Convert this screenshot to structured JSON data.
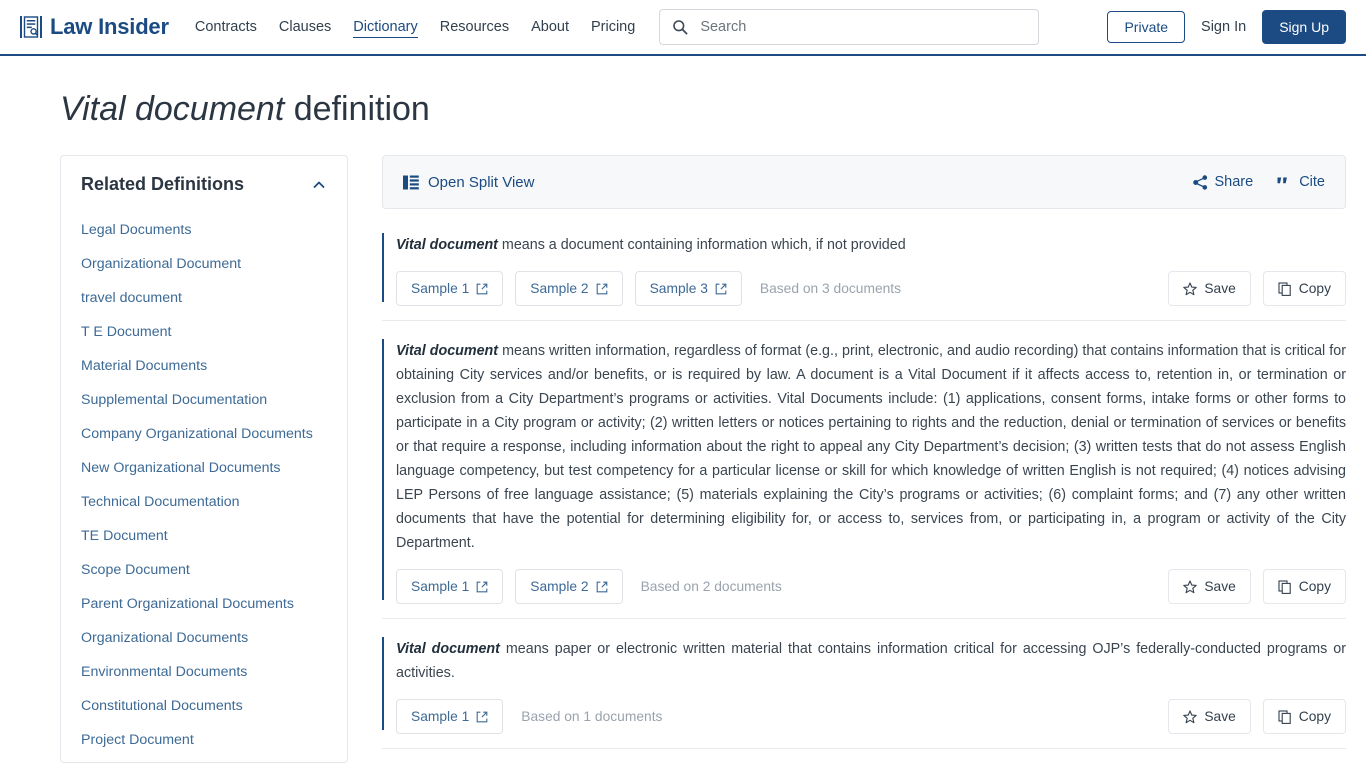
{
  "header": {
    "logo_text": "Law Insider",
    "logo_icon": "document-search-icon",
    "nav": [
      {
        "label": "Contracts",
        "active": false
      },
      {
        "label": "Clauses",
        "active": false
      },
      {
        "label": "Dictionary",
        "active": true
      },
      {
        "label": "Resources",
        "active": false
      },
      {
        "label": "About",
        "active": false
      },
      {
        "label": "Pricing",
        "active": false
      }
    ],
    "search": {
      "placeholder": "Search",
      "value": "",
      "icon": "search-icon"
    },
    "private_label": "Private",
    "signin_label": "Sign In",
    "signup_label": "Sign Up",
    "accent_color": "#1b4b82"
  },
  "page": {
    "title_term": "Vital document",
    "title_suffix": " definition"
  },
  "sidebar": {
    "title": "Related Definitions",
    "collapse_icon": "chevron-up-icon",
    "items": [
      {
        "label": "Legal Documents"
      },
      {
        "label": "Organizational Document"
      },
      {
        "label": "travel document"
      },
      {
        "label": "T E Document"
      },
      {
        "label": "Material Documents"
      },
      {
        "label": "Supplemental Documentation"
      },
      {
        "label": "Company Organizational Documents"
      },
      {
        "label": "New Organizational Documents"
      },
      {
        "label": "Technical Documentation"
      },
      {
        "label": "TE Document"
      },
      {
        "label": "Scope Document"
      },
      {
        "label": "Parent Organizational Documents"
      },
      {
        "label": "Organizational Documents"
      },
      {
        "label": "Environmental Documents"
      },
      {
        "label": "Constitutional Documents"
      },
      {
        "label": "Project Document"
      }
    ]
  },
  "toolbar": {
    "split_view_label": "Open Split View",
    "split_view_icon": "split-view-icon",
    "share_label": "Share",
    "share_icon": "share-icon",
    "cite_label": "Cite",
    "cite_icon": "quote-icon"
  },
  "definitions": [
    {
      "term": "Vital document",
      "body": " means a document containing information which, if not provided",
      "samples": [
        {
          "label": "Sample 1",
          "icon": "external-link-icon"
        },
        {
          "label": "Sample 2",
          "icon": "external-link-icon"
        },
        {
          "label": "Sample 3",
          "icon": "external-link-icon"
        }
      ],
      "based_on": "Based on 3 documents",
      "save_label": "Save",
      "save_icon": "star-icon",
      "copy_label": "Copy",
      "copy_icon": "copy-icon"
    },
    {
      "term": "Vital document",
      "body": " means written information, regardless of format (e.g., print, electronic, and audio recording) that contains information that is critical for obtaining City services and/or benefits, or is required by law. A document is a Vital Document if it affects access to, retention in, or termination or exclusion from a City Department’s programs or activities. Vital Documents include: (1) applications, consent forms, intake forms or other forms to participate in a City program or activity; (2) written letters or notices pertaining to rights and the reduction, denial or termination of services or benefits or that require a response, including information about the right to appeal any City Department’s decision; (3) written tests that do not assess English language competency, but test competency for a particular license or skill for which knowledge of written English is not required; (4) notices advising LEP Persons of free language assistance; (5) materials explaining the City’s programs or activities; (6) complaint forms; and (7) any other written documents that have the potential for determining eligibility for, or access to, services from, or participating in, a program or activity of the City Department.",
      "samples": [
        {
          "label": "Sample 1",
          "icon": "external-link-icon"
        },
        {
          "label": "Sample 2",
          "icon": "external-link-icon"
        }
      ],
      "based_on": "Based on 2 documents",
      "save_label": "Save",
      "save_icon": "star-icon",
      "copy_label": "Copy",
      "copy_icon": "copy-icon"
    },
    {
      "term": "Vital document",
      "body": " means paper or electronic written material that contains information critical for accessing OJP’s federally-conducted programs or activities.",
      "samples": [
        {
          "label": "Sample 1",
          "icon": "external-link-icon"
        }
      ],
      "based_on": "Based on 1 documents",
      "save_label": "Save",
      "save_icon": "star-icon",
      "copy_label": "Copy",
      "copy_icon": "copy-icon"
    }
  ]
}
